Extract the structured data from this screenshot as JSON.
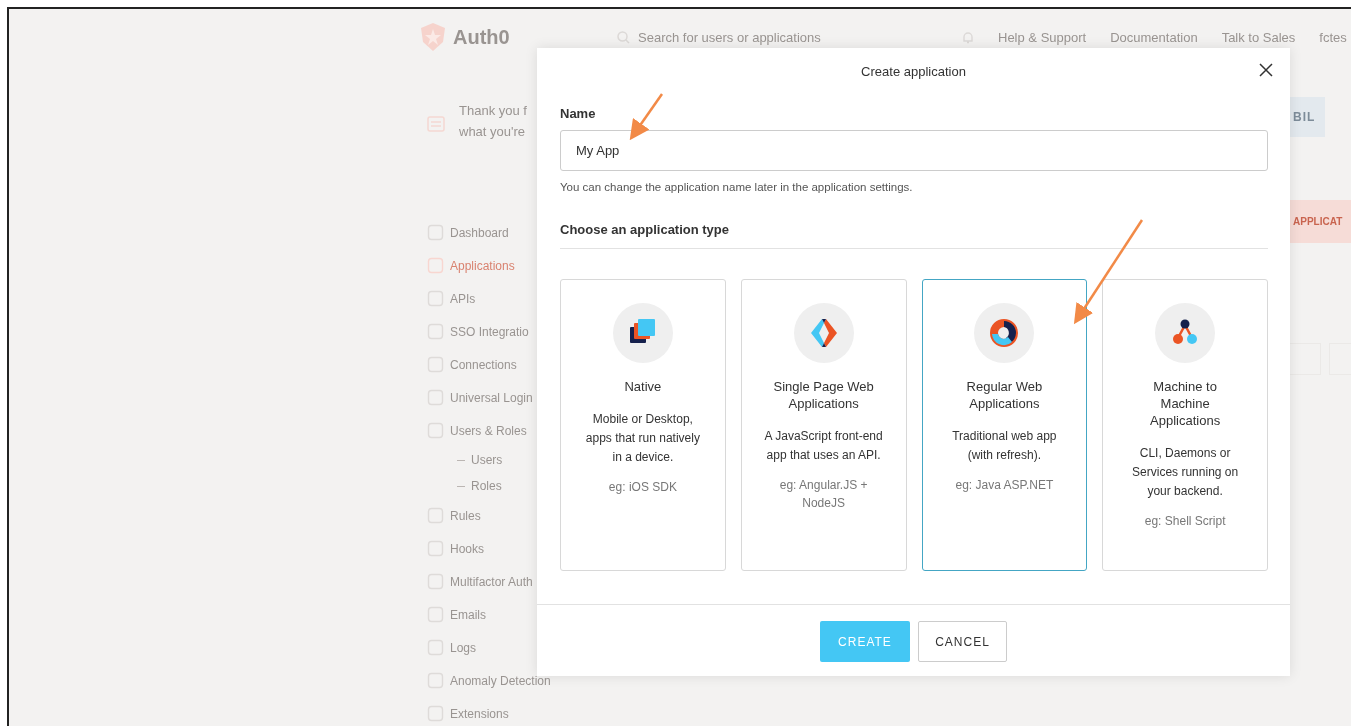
{
  "header": {
    "logo": "Auth0",
    "search_placeholder": "Search for users or applications",
    "links": [
      "Help & Support",
      "Documentation",
      "Talk to Sales",
      "fctes"
    ]
  },
  "banner": {
    "lines": [
      "Thank you f",
      "what you're"
    ],
    "button": "BIL"
  },
  "sidebar": {
    "items": [
      {
        "label": "Dashboard",
        "selected": false
      },
      {
        "label": "Applications",
        "selected": true
      },
      {
        "label": "APIs",
        "selected": false
      },
      {
        "label": "SSO Integratio",
        "selected": false
      },
      {
        "label": "Connections",
        "selected": false
      },
      {
        "label": "Universal Login",
        "selected": false
      },
      {
        "label": "Users & Roles",
        "selected": false,
        "children": [
          {
            "label": "Users",
            "selected": false
          },
          {
            "label": "Roles",
            "selected": false
          }
        ]
      },
      {
        "label": "Rules",
        "selected": false
      },
      {
        "label": "Hooks",
        "selected": false
      },
      {
        "label": "Multifactor Auth",
        "selected": false
      },
      {
        "label": "Emails",
        "selected": false
      },
      {
        "label": "Logs",
        "selected": false
      },
      {
        "label": "Anomaly Detection",
        "selected": false
      },
      {
        "label": "Extensions",
        "selected": false
      }
    ]
  },
  "page_button": "APPLICAT",
  "modal": {
    "title": "Create application",
    "name_label": "Name",
    "name_value": "My App",
    "helper": "You can change the application name later in the application settings.",
    "section_title": "Choose an application type",
    "types": [
      {
        "kind": "native",
        "title": "Native",
        "description": "Mobile or Desktop, apps that run natively in a device.",
        "example": "eg: iOS SDK",
        "selected": false
      },
      {
        "kind": "spa",
        "title": "Single Page Web Applications",
        "description": "A JavaScript front-end app that uses an API.",
        "example": "eg: Angular.JS + NodeJS",
        "selected": false
      },
      {
        "kind": "regular",
        "title": "Regular Web Applications",
        "description": "Traditional web app (with refresh).",
        "example": "eg: Java ASP.NET",
        "selected": true
      },
      {
        "kind": "m2m",
        "title": "Machine to Machine Applications",
        "description": "CLI, Daemons or Services running on your backend.",
        "example": "eg: Shell Script",
        "selected": false
      }
    ],
    "buttons": [
      {
        "label": "CREATE",
        "kind": "primary"
      },
      {
        "label": "CANCEL",
        "kind": "secondary"
      }
    ]
  }
}
